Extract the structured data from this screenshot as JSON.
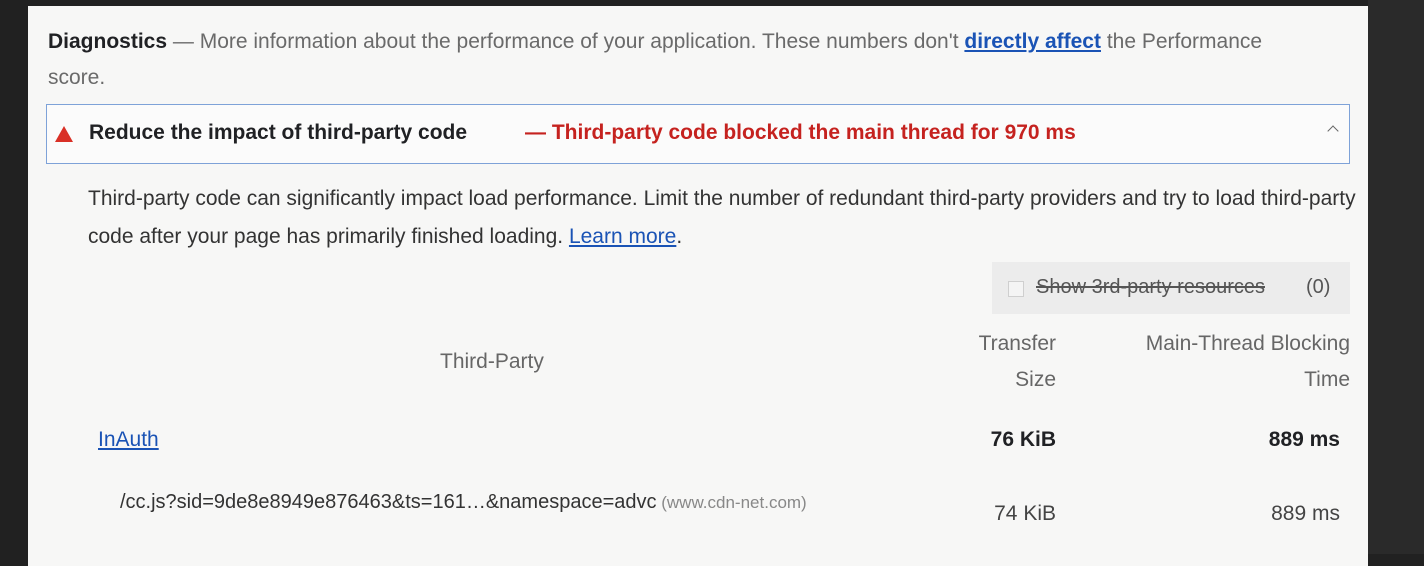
{
  "diagnostics": {
    "label": "Diagnostics",
    "dash": " — ",
    "text_before": "More information about the performance of your application. These numbers don't ",
    "link": "directly affect",
    "text_after": " the Performance score."
  },
  "audit": {
    "title": "Reduce the impact of third-party code",
    "display_value": "— Third-party code blocked the main thread for 970 ms",
    "description": "Third-party code can significantly impact load performance. Limit the number of redundant third-party providers and try to load third-party code after your page has primarily finished loading. ",
    "learn_more": "Learn more",
    "period": "."
  },
  "filter": {
    "label": "Show 3rd-party resources",
    "count": " (0)",
    "checked": false
  },
  "table": {
    "headers": {
      "third_party": "Third-Party",
      "transfer_size_1": "Transfer",
      "transfer_size_2": "Size",
      "blocking_1": "Main-Thread Blocking",
      "blocking_2": "Time"
    },
    "rows": [
      {
        "entity": "InAuth",
        "transfer_size": "76 KiB",
        "blocking_time": "889 ms"
      }
    ],
    "subrows": [
      {
        "url": "/cc.js?sid=9de8e8949e876463&ts=161…&namespace=advc",
        "host": " (www.cdn-net.com)",
        "transfer_size": "74 KiB",
        "blocking_time": "889 ms"
      }
    ]
  },
  "colors": {
    "link": "#1a53b5",
    "warning": "#d93026",
    "display_value": "#c5221f",
    "header_border": "#7ea2d8"
  },
  "icons": {
    "warning": "warning-triangle-icon",
    "expand": "chevron-up-icon"
  }
}
